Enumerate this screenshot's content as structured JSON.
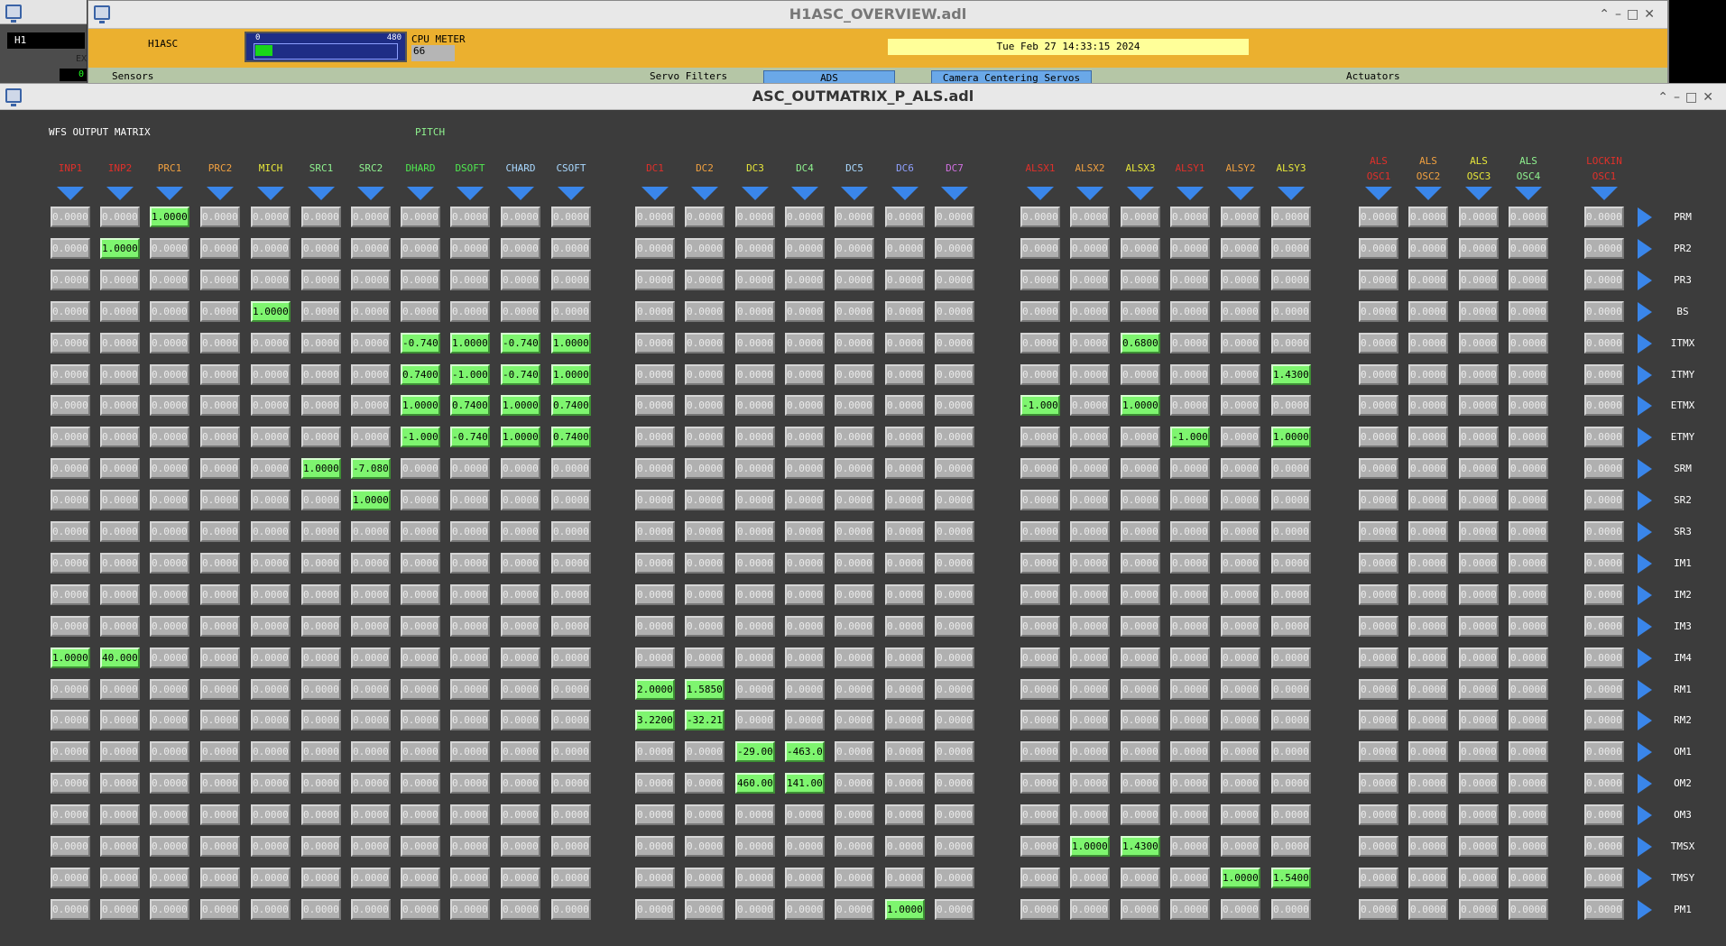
{
  "bg_window": {
    "prefix": "H1",
    "ex": "EX",
    "zero": "0"
  },
  "overview": {
    "title": "H1ASC_OVERVIEW.adl",
    "system": "H1ASC",
    "cpu": {
      "label": "CPU METER",
      "value": "66",
      "min": "0",
      "max": "480",
      "level_fraction": 0.12
    },
    "datetime": "Tue Feb 27 14:33:15 2024",
    "sections": {
      "sensors": "Sensors",
      "servo_filters": "Servo Filters",
      "actuators": "Actuators"
    },
    "buttons": {
      "ads": "ADS",
      "camera": "Camera Centering Servos"
    }
  },
  "main": {
    "title": "ASC_OUTMATRIX_P_ALS.adl",
    "header": "WFS OUTPUT MATRIX",
    "subheader": "PITCH",
    "colors": {
      "active": "#7ef56f",
      "inactive": "#b0b0b0",
      "arrow": "#3a86ea"
    },
    "columns": [
      {
        "label": [
          "INP1"
        ],
        "color": "#e0302a"
      },
      {
        "label": [
          "INP2"
        ],
        "color": "#e0302a"
      },
      {
        "label": [
          "PRC1"
        ],
        "color": "#f0a040"
      },
      {
        "label": [
          "PRC2"
        ],
        "color": "#f0a040"
      },
      {
        "label": [
          "MICH"
        ],
        "color": "#e6e63a"
      },
      {
        "label": [
          "SRC1"
        ],
        "color": "#8ff28f"
      },
      {
        "label": [
          "SRC2"
        ],
        "color": "#8ff28f"
      },
      {
        "label": [
          "DHARD"
        ],
        "color": "#50e850"
      },
      {
        "label": [
          "DSOFT"
        ],
        "color": "#50e850"
      },
      {
        "label": [
          "CHARD"
        ],
        "color": "#a8d8ff"
      },
      {
        "label": [
          "CSOFT"
        ],
        "color": "#a8d8ff"
      },
      {
        "label": [
          "DC1"
        ],
        "color": "#e0302a"
      },
      {
        "label": [
          "DC2"
        ],
        "color": "#f0a040"
      },
      {
        "label": [
          "DC3"
        ],
        "color": "#e6e63a"
      },
      {
        "label": [
          "DC4"
        ],
        "color": "#8ff28f"
      },
      {
        "label": [
          "DC5"
        ],
        "color": "#a8d8ff"
      },
      {
        "label": [
          "DC6"
        ],
        "color": "#8fa0ff"
      },
      {
        "label": [
          "DC7"
        ],
        "color": "#d070e0"
      },
      {
        "label": [
          "ALSX1"
        ],
        "color": "#e0302a"
      },
      {
        "label": [
          "ALSX2"
        ],
        "color": "#f0a040"
      },
      {
        "label": [
          "ALSX3"
        ],
        "color": "#e6e63a"
      },
      {
        "label": [
          "ALSY1"
        ],
        "color": "#e0302a"
      },
      {
        "label": [
          "ALSY2"
        ],
        "color": "#f0a040"
      },
      {
        "label": [
          "ALSY3"
        ],
        "color": "#e6e63a"
      },
      {
        "label": [
          "ALS",
          "OSC1"
        ],
        "color": "#e0302a"
      },
      {
        "label": [
          "ALS",
          "OSC2"
        ],
        "color": "#f0a040"
      },
      {
        "label": [
          "ALS",
          "OSC3"
        ],
        "color": "#e6e63a"
      },
      {
        "label": [
          "ALS",
          "OSC4"
        ],
        "color": "#8ff28f"
      },
      {
        "label": [
          "LOCKIN",
          "OSC1"
        ],
        "color": "#e0302a"
      }
    ],
    "rows": [
      "PRM",
      "PR2",
      "PR3",
      "BS",
      "ITMX",
      "ITMY",
      "ETMX",
      "ETMY",
      "SRM",
      "SR2",
      "SR3",
      "IM1",
      "IM2",
      "IM3",
      "IM4",
      "RM1",
      "RM2",
      "OM1",
      "OM2",
      "OM3",
      "TMSX",
      "TMSY",
      "PM1"
    ],
    "default_value": "0.00000",
    "active_cells": [
      {
        "row": 0,
        "col": 2,
        "value": "1.00000"
      },
      {
        "row": 1,
        "col": 1,
        "value": "1.00000"
      },
      {
        "row": 3,
        "col": 4,
        "value": "1.00000"
      },
      {
        "row": 4,
        "col": 7,
        "value": "-0.7400"
      },
      {
        "row": 4,
        "col": 8,
        "value": "1.00000"
      },
      {
        "row": 4,
        "col": 9,
        "value": "-0.7400"
      },
      {
        "row": 4,
        "col": 10,
        "value": "1.00000"
      },
      {
        "row": 4,
        "col": 20,
        "value": "0.68000"
      },
      {
        "row": 5,
        "col": 7,
        "value": "0.74000"
      },
      {
        "row": 5,
        "col": 8,
        "value": "-1.0000"
      },
      {
        "row": 5,
        "col": 9,
        "value": "-0.7400"
      },
      {
        "row": 5,
        "col": 10,
        "value": "1.00000"
      },
      {
        "row": 5,
        "col": 23,
        "value": "1.43000"
      },
      {
        "row": 6,
        "col": 7,
        "value": "1.00000"
      },
      {
        "row": 6,
        "col": 8,
        "value": "0.74000"
      },
      {
        "row": 6,
        "col": 9,
        "value": "1.00000"
      },
      {
        "row": 6,
        "col": 10,
        "value": "0.74000"
      },
      {
        "row": 6,
        "col": 18,
        "value": "-1.0000"
      },
      {
        "row": 6,
        "col": 20,
        "value": "1.00000"
      },
      {
        "row": 7,
        "col": 7,
        "value": "-1.0000"
      },
      {
        "row": 7,
        "col": 8,
        "value": "-0.7400"
      },
      {
        "row": 7,
        "col": 9,
        "value": "1.00000"
      },
      {
        "row": 7,
        "col": 10,
        "value": "0.74000"
      },
      {
        "row": 7,
        "col": 21,
        "value": "-1.0000"
      },
      {
        "row": 7,
        "col": 23,
        "value": "1.00000"
      },
      {
        "row": 8,
        "col": 5,
        "value": "1.00000"
      },
      {
        "row": 8,
        "col": 6,
        "value": "-7.0800"
      },
      {
        "row": 9,
        "col": 6,
        "value": "1.00000"
      },
      {
        "row": 14,
        "col": 0,
        "value": "1.00000"
      },
      {
        "row": 14,
        "col": 1,
        "value": "40.0000"
      },
      {
        "row": 15,
        "col": 11,
        "value": "2.00000"
      },
      {
        "row": 15,
        "col": 12,
        "value": "1.58500"
      },
      {
        "row": 16,
        "col": 11,
        "value": "3.22000"
      },
      {
        "row": 16,
        "col": 12,
        "value": "-32.210"
      },
      {
        "row": 17,
        "col": 13,
        "value": "-29.000"
      },
      {
        "row": 17,
        "col": 14,
        "value": "-463.00"
      },
      {
        "row": 18,
        "col": 13,
        "value": "460.000"
      },
      {
        "row": 18,
        "col": 14,
        "value": "141.000"
      },
      {
        "row": 20,
        "col": 19,
        "value": "1.00000"
      },
      {
        "row": 20,
        "col": 20,
        "value": "1.43000"
      },
      {
        "row": 21,
        "col": 22,
        "value": "1.00000"
      },
      {
        "row": 21,
        "col": 23,
        "value": "1.54000"
      },
      {
        "row": 22,
        "col": 16,
        "value": "1.00000"
      }
    ]
  }
}
